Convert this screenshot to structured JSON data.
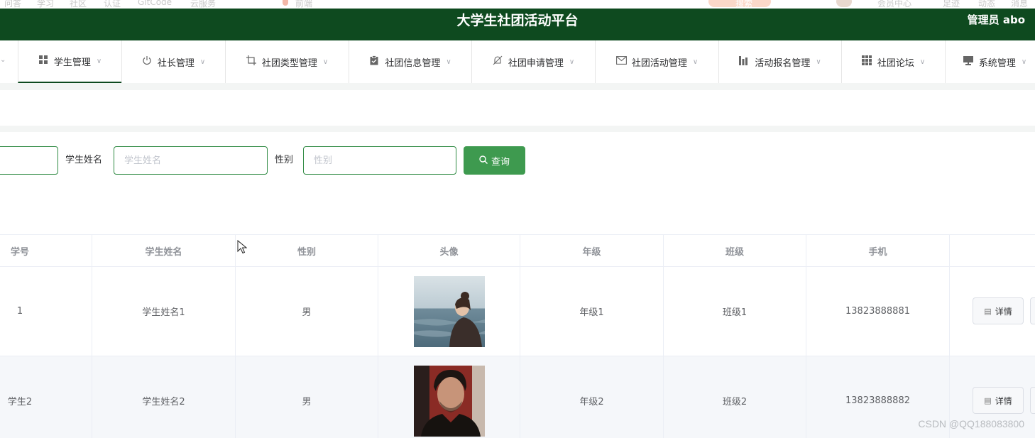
{
  "browser_strip": {
    "items": [
      "问答",
      "学习",
      "社区",
      "认证",
      "GitCode",
      "云服务",
      "前端",
      "搜索",
      "会员中心",
      "足迹",
      "动态",
      "消息"
    ]
  },
  "header": {
    "title": "大学生社团活动平台",
    "user": "管理员 abo",
    "bg_color": "#0e4a1f"
  },
  "nav": {
    "items": [
      {
        "label": "学生管理",
        "icon": "grid-icon",
        "active": true
      },
      {
        "label": "社长管理",
        "icon": "power-icon"
      },
      {
        "label": "社团类型管理",
        "icon": "crop-icon"
      },
      {
        "label": "社团信息管理",
        "icon": "clipboard-check-icon"
      },
      {
        "label": "社团申请管理",
        "icon": "bell-off-icon"
      },
      {
        "label": "社团活动管理",
        "icon": "mail-icon"
      },
      {
        "label": "活动报名管理",
        "icon": "bar-chart-icon"
      },
      {
        "label": "社团论坛",
        "icon": "menu-grid-icon"
      },
      {
        "label": "系统管理",
        "icon": "monitor-icon"
      }
    ]
  },
  "search": {
    "name_label": "学生姓名",
    "name_placeholder": "学生姓名",
    "gender_label": "性别",
    "gender_placeholder": "性别",
    "button_label": "查询",
    "accent_color": "#3e9a4f"
  },
  "table": {
    "columns": [
      "学号",
      "学生姓名",
      "性别",
      "头像",
      "年级",
      "班级",
      "手机"
    ],
    "rows": [
      {
        "id": "1",
        "name": "学生姓名1",
        "gender": "男",
        "avatar": "woman-by-sea-photo",
        "grade": "年级1",
        "class": "班级1",
        "phone": "13823888881",
        "action": "详情"
      },
      {
        "id": "学生2",
        "name": "学生姓名2",
        "gender": "男",
        "avatar": "man-portrait-photo",
        "grade": "年级2",
        "class": "班级2",
        "phone": "13823888882",
        "action": "详情"
      }
    ]
  },
  "watermark": "CSDN @QQ188083800"
}
